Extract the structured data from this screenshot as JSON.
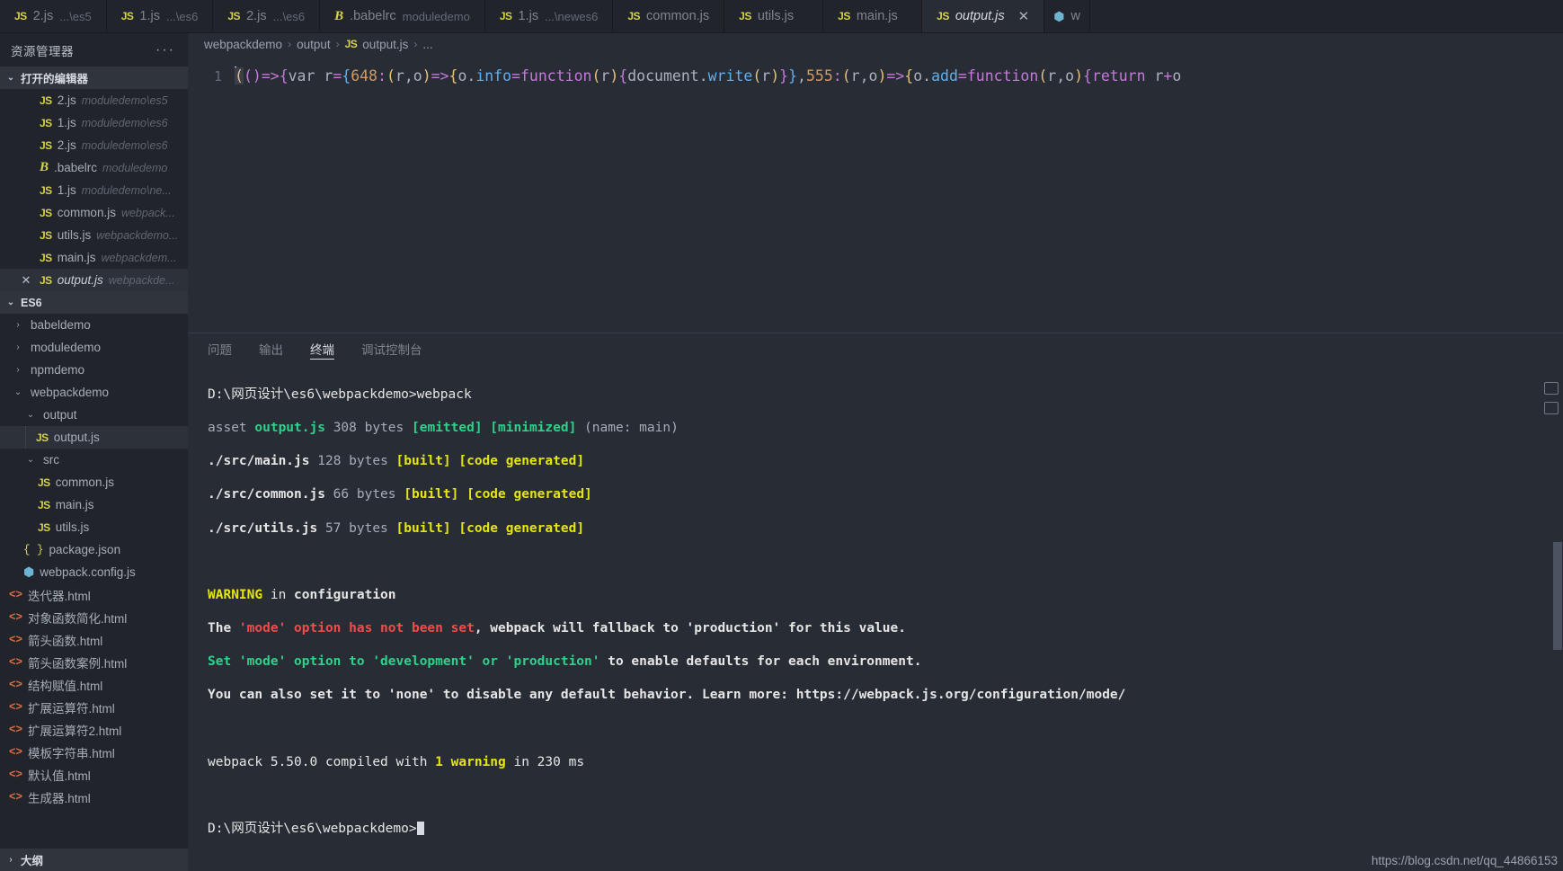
{
  "sidebar": {
    "title": "资源管理器",
    "more_label": "···",
    "open_editors": {
      "label": "打开的编辑器",
      "items": [
        {
          "icon": "js-icon",
          "name": "2.js",
          "path": "moduledemo\\es5",
          "active": false,
          "closable": false
        },
        {
          "icon": "js-icon",
          "name": "1.js",
          "path": "moduledemo\\es6",
          "active": false,
          "closable": false
        },
        {
          "icon": "js-icon",
          "name": "2.js",
          "path": "moduledemo\\es6",
          "active": false,
          "closable": false
        },
        {
          "icon": "babel-icon",
          "name": ".babelrc",
          "path": "moduledemo",
          "active": false,
          "closable": false
        },
        {
          "icon": "js-icon",
          "name": "1.js",
          "path": "moduledemo\\ne...",
          "active": false,
          "closable": false
        },
        {
          "icon": "js-icon",
          "name": "common.js",
          "path": "webpack...",
          "active": false,
          "closable": false
        },
        {
          "icon": "js-icon",
          "name": "utils.js",
          "path": "webpackdemo...",
          "active": false,
          "closable": false
        },
        {
          "icon": "js-icon",
          "name": "main.js",
          "path": "webpackdem...",
          "active": false,
          "closable": false
        },
        {
          "icon": "js-icon",
          "name": "output.js",
          "path": "webpackde...",
          "active": true,
          "closable": true
        }
      ]
    },
    "workspace": {
      "label": "ES6",
      "tree": [
        {
          "label": "babeldemo",
          "type": "folder",
          "expanded": false,
          "depth": 1,
          "icon": "chevron-right-icon"
        },
        {
          "label": "moduledemo",
          "type": "folder",
          "expanded": false,
          "depth": 1,
          "icon": "chevron-right-icon"
        },
        {
          "label": "npmdemo",
          "type": "folder",
          "expanded": false,
          "depth": 1,
          "icon": "chevron-right-icon"
        },
        {
          "label": "webpackdemo",
          "type": "folder",
          "expanded": true,
          "depth": 1,
          "icon": "chevron-down-icon"
        },
        {
          "label": "output",
          "type": "folder",
          "expanded": true,
          "depth": 2,
          "icon": "chevron-down-icon"
        },
        {
          "label": "output.js",
          "type": "file",
          "icon": "js-icon",
          "depth": 3,
          "selected": true
        },
        {
          "label": "src",
          "type": "folder",
          "expanded": true,
          "depth": 2,
          "icon": "chevron-down-icon"
        },
        {
          "label": "common.js",
          "type": "file",
          "icon": "js-icon",
          "depth": 3
        },
        {
          "label": "main.js",
          "type": "file",
          "icon": "js-icon",
          "depth": 3
        },
        {
          "label": "utils.js",
          "type": "file",
          "icon": "js-icon",
          "depth": 3
        },
        {
          "label": "package.json",
          "type": "file",
          "icon": "json-icon",
          "depth": 2
        },
        {
          "label": "webpack.config.js",
          "type": "file",
          "icon": "webpack-icon",
          "depth": 2
        },
        {
          "label": "迭代器.html",
          "type": "file",
          "icon": "html-icon",
          "depth": 1
        },
        {
          "label": "对象函数简化.html",
          "type": "file",
          "icon": "html-icon",
          "depth": 1
        },
        {
          "label": "箭头函数.html",
          "type": "file",
          "icon": "html-icon",
          "depth": 1
        },
        {
          "label": "箭头函数案例.html",
          "type": "file",
          "icon": "html-icon",
          "depth": 1
        },
        {
          "label": "结构赋值.html",
          "type": "file",
          "icon": "html-icon",
          "depth": 1
        },
        {
          "label": "扩展运算符.html",
          "type": "file",
          "icon": "html-icon",
          "depth": 1
        },
        {
          "label": "扩展运算符2.html",
          "type": "file",
          "icon": "html-icon",
          "depth": 1
        },
        {
          "label": "模板字符串.html",
          "type": "file",
          "icon": "html-icon",
          "depth": 1
        },
        {
          "label": "默认值.html",
          "type": "file",
          "icon": "html-icon",
          "depth": 1
        },
        {
          "label": "生成器.html",
          "type": "file",
          "icon": "html-icon",
          "depth": 1
        }
      ]
    },
    "outline_label": "大纲"
  },
  "tabs": [
    {
      "icon": "js-icon",
      "label": "2.js",
      "sub": "...\\es5",
      "active": false
    },
    {
      "icon": "js-icon",
      "label": "1.js",
      "sub": "...\\es6",
      "active": false
    },
    {
      "icon": "js-icon",
      "label": "2.js",
      "sub": "...\\es6",
      "active": false
    },
    {
      "icon": "babel-icon",
      "label": ".babelrc",
      "sub": "moduledemo",
      "active": false
    },
    {
      "icon": "js-icon",
      "label": "1.js",
      "sub": "...\\newes6",
      "active": false
    },
    {
      "icon": "js-icon",
      "label": "common.js",
      "sub": "",
      "active": false
    },
    {
      "icon": "js-icon",
      "label": "utils.js",
      "sub": "",
      "active": false
    },
    {
      "icon": "js-icon",
      "label": "main.js",
      "sub": "",
      "active": false
    },
    {
      "icon": "js-icon",
      "label": "output.js",
      "sub": "",
      "active": true,
      "close": "✕"
    },
    {
      "icon": "webpack-icon",
      "label": "w",
      "sub": "",
      "active": false
    }
  ],
  "breadcrumb": {
    "parts": [
      "webpackdemo",
      "output",
      "output.js",
      "..."
    ],
    "separator": "›",
    "file_icon": "js-icon"
  },
  "editor": {
    "line_number": "1",
    "code": "(()=>{var r={648:(r,o)=>{o.info=function(r){document.write(r)}},555:(r,o)=>{o.add=function(r,o){return r+o"
  },
  "panel": {
    "tabs": [
      {
        "label": "问题",
        "active": false
      },
      {
        "label": "输出",
        "active": false
      },
      {
        "label": "终端",
        "active": true
      },
      {
        "label": "调试控制台",
        "active": false
      }
    ],
    "terminal_lines": [
      "D:\\网页设计\\es6\\webpackdemo>webpack",
      "asset output.js 308 bytes [emitted] [minimized] (name: main)",
      "./src/main.js 128 bytes [built] [code generated]",
      "./src/common.js 66 bytes [built] [code generated]",
      "./src/utils.js 57 bytes [built] [code generated]",
      "",
      "WARNING in configuration",
      "The 'mode' option has not been set, webpack will fallback to 'production' for this value.",
      "Set 'mode' option to 'development' or 'production' to enable defaults for each environment.",
      "You can also set it to 'none' to disable any default behavior. Learn more: https://webpack.js.org/configuration/mode/",
      "",
      "webpack 5.50.0 compiled with 1 warning in 230 ms",
      "",
      "D:\\网页设计\\es6\\webpackdemo>"
    ]
  },
  "watermark": "https://blog.csdn.net/qq_44866153"
}
